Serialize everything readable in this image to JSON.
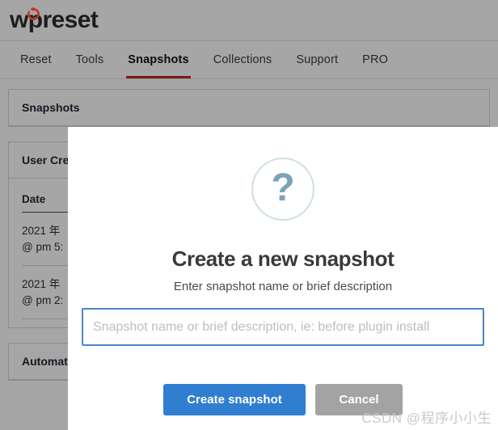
{
  "app": {
    "logo": {
      "text_before": "w",
      "text_p": "p",
      "text_after": "reset",
      "icon": "reset-arrow-icon",
      "accent_color": "#c0392b"
    }
  },
  "nav": {
    "items": [
      {
        "label": "Reset",
        "active": false
      },
      {
        "label": "Tools",
        "active": false
      },
      {
        "label": "Snapshots",
        "active": true
      },
      {
        "label": "Collections",
        "active": false
      },
      {
        "label": "Support",
        "active": false
      },
      {
        "label": "PRO",
        "active": false
      }
    ],
    "active_underline_color": "#c02727"
  },
  "background": {
    "panels": [
      {
        "title": "Snapshots"
      },
      {
        "title": "User Created Snapshots"
      },
      {
        "title": "Automatic Snapshots"
      }
    ],
    "table": {
      "columns": [
        "Date"
      ],
      "rows": [
        {
          "date_line1": "2021 年",
          "date_line2": "@ pm 5:"
        },
        {
          "date_line1": "2021 年",
          "date_line2": "@ pm 2:"
        }
      ]
    }
  },
  "modal": {
    "icon": "question-mark-icon",
    "icon_glyph": "?",
    "title": "Create a new snapshot",
    "subtitle": "Enter snapshot name or brief description",
    "input": {
      "value": "",
      "placeholder": "Snapshot name or brief description, ie: before plugin install",
      "border_color": "#4a86c8"
    },
    "buttons": {
      "primary_label": "Create snapshot",
      "primary_color": "#2f7ed0",
      "cancel_label": "Cancel",
      "cancel_color": "#a3a3a3"
    }
  },
  "watermark": {
    "text": "CSDN @程序小小生"
  }
}
